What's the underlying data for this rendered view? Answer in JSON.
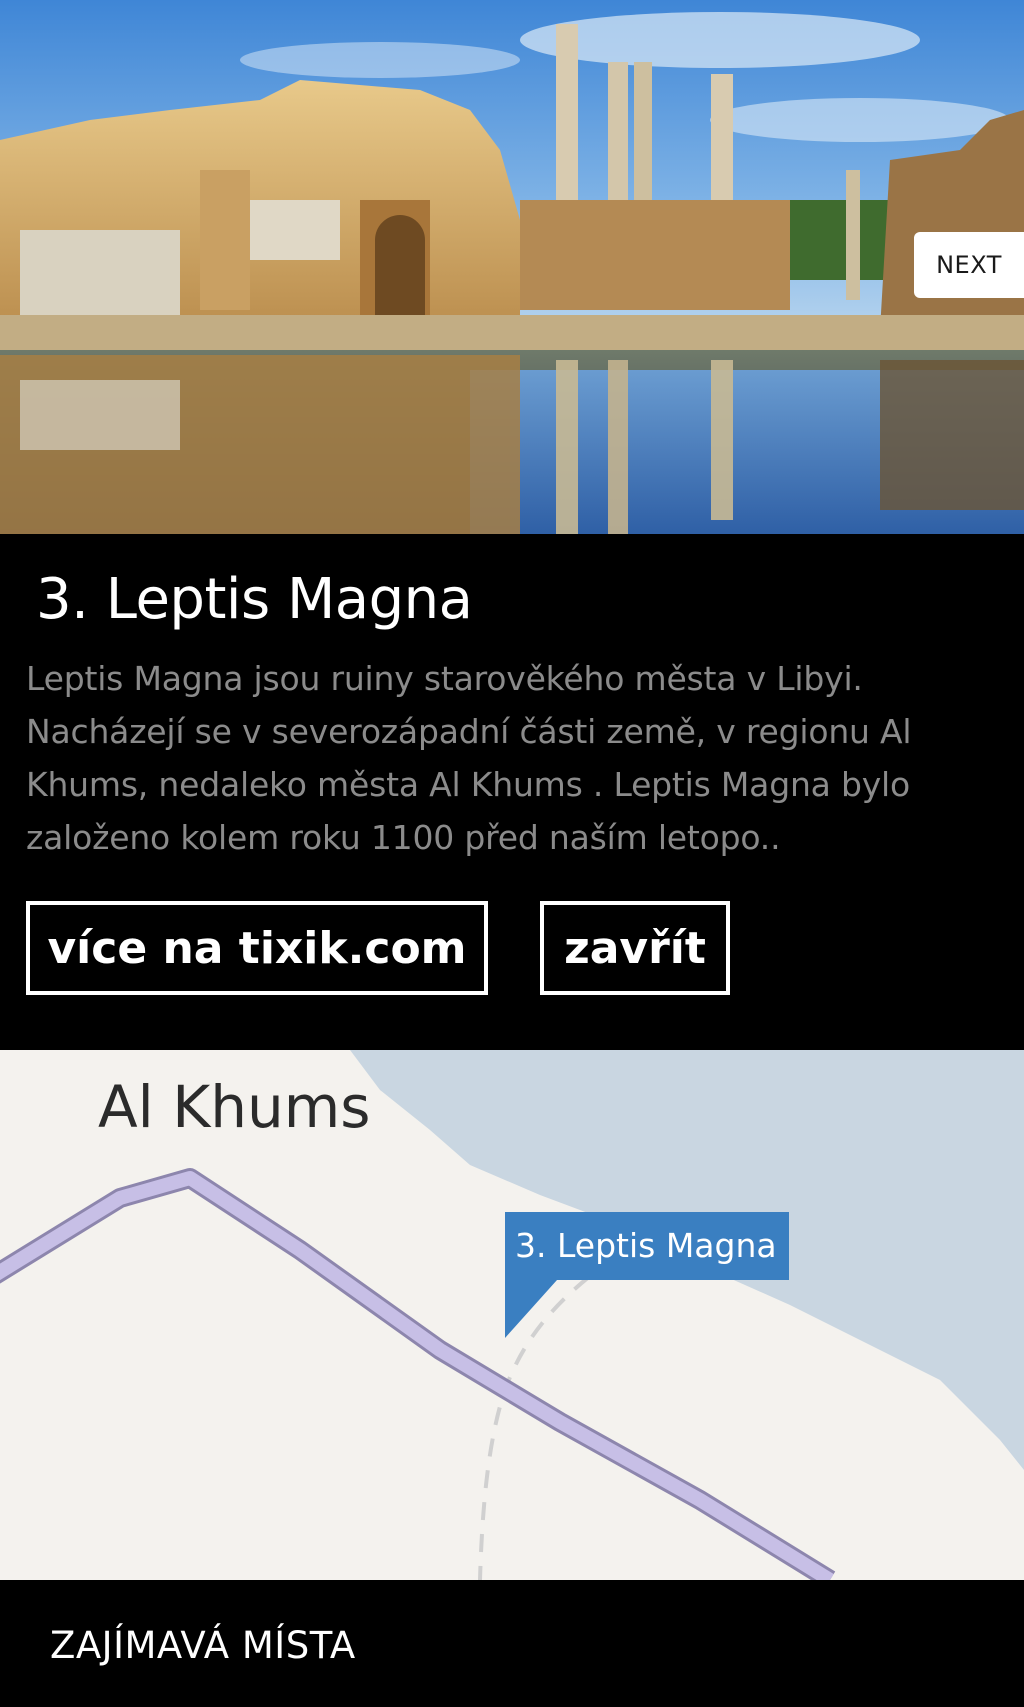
{
  "photo": {
    "next_label": "NEXT"
  },
  "info": {
    "title": "3. Leptis Magna",
    "description": "Leptis Magna jsou ruiny starověkého města v Libyi. Nacházejí se v severozápadní části země, v regionu Al Khums, nedaleko města Al Khums . Leptis Magna bylo založeno kolem roku 1100 před naším letopo..",
    "more_button": "více na tixik.com",
    "close_button": "zavřít"
  },
  "map": {
    "city_label": "Al Khums",
    "pin_label": "3. Leptis Magna",
    "colors": {
      "land": "#f4f2ee",
      "water": "#c9d6e1",
      "road": "#c7bfe6",
      "pin": "#3a7fc1"
    }
  },
  "bottom_bar": {
    "label": "ZAJÍMAVÁ MÍSTA"
  }
}
